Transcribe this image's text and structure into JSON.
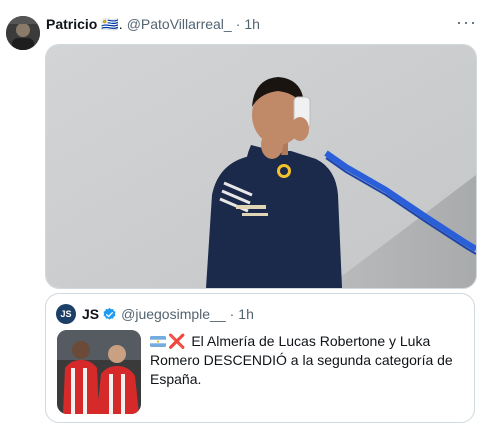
{
  "post": {
    "author_name": "Patricio",
    "author_flag": "🇺🇾.",
    "handle": "@PatoVillarreal_",
    "separator": "·",
    "time": "1h",
    "more_label": "···"
  },
  "quoted": {
    "avatar_text": "JS",
    "author_name": "JS",
    "handle": "@juegosimple__",
    "separator": "·",
    "time": "1h",
    "cross": "❌",
    "text": "El Almería de Lucas Robertone y Luka Romero DESCENDIÓ a la segunda categoría de España."
  },
  "colors": {
    "accent": "#1d9bf0",
    "muted": "#536471",
    "border": "#cfd9de"
  },
  "icons": [
    "more-icon",
    "verified-badge-icon",
    "argentina-flag-icon"
  ]
}
